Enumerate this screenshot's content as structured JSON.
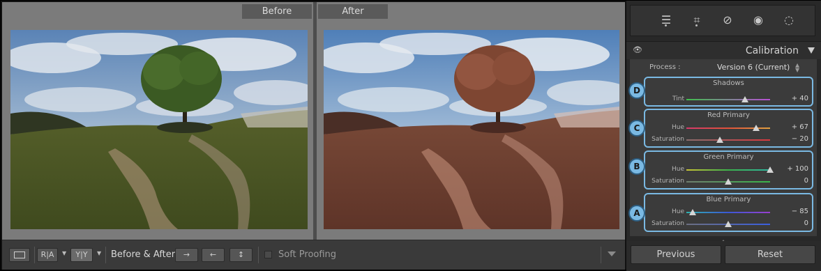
{
  "panes": {
    "before_label": "Before",
    "after_label": "After"
  },
  "toolbar": {
    "view_loupe": "",
    "view_ra": "R|A",
    "view_yy": "Y|Y",
    "before_after_label": "Before & After :",
    "soft_proofing_label": "Soft Proofing"
  },
  "panel": {
    "title": "Calibration",
    "process_label": "Process :",
    "process_value": "Version 6 (Current)",
    "groups": [
      {
        "badge": "D",
        "title": "Shadows",
        "sliders": [
          {
            "label": "Tint",
            "display": "+ 40",
            "value": 40
          }
        ]
      },
      {
        "badge": "C",
        "title": "Red Primary",
        "sliders": [
          {
            "label": "Hue",
            "display": "+ 67",
            "value": 67
          },
          {
            "label": "Saturation",
            "display": "− 20",
            "value": -20
          }
        ]
      },
      {
        "badge": "B",
        "title": "Green Primary",
        "sliders": [
          {
            "label": "Hue",
            "display": "+ 100",
            "value": 100
          },
          {
            "label": "Saturation",
            "display": "0",
            "value": 0
          }
        ]
      },
      {
        "badge": "A",
        "title": "Blue Primary",
        "sliders": [
          {
            "label": "Hue",
            "display": "− 85",
            "value": -85
          },
          {
            "label": "Saturation",
            "display": "0",
            "value": 0
          }
        ]
      }
    ],
    "previous_label": "Previous",
    "reset_label": "Reset"
  },
  "colors": {
    "highlight": "#7ab9e3",
    "panel_bg": "#3b3b3b",
    "work_bg": "#7b7b7b"
  }
}
